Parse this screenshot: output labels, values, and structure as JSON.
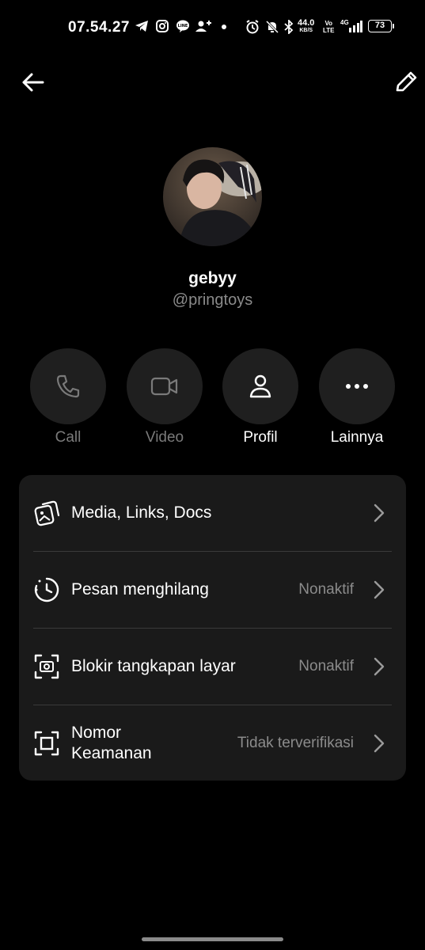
{
  "status_bar": {
    "time": "07.54.27",
    "speed_value": "44.0",
    "speed_unit": "KB/S",
    "volte_top": "Vo",
    "volte_bottom": "LTE",
    "network": "4G",
    "battery": "73"
  },
  "profile": {
    "display_name": "gebyy",
    "username": "@pringtoys"
  },
  "actions": [
    {
      "label": "Call",
      "icon": "phone-icon",
      "enabled": false
    },
    {
      "label": "Video",
      "icon": "video-icon",
      "enabled": false
    },
    {
      "label": "Profil",
      "icon": "person-icon",
      "enabled": true
    },
    {
      "label": "Lainnya",
      "icon": "more-icon",
      "enabled": true
    }
  ],
  "settings": [
    {
      "label": "Media, Links, Docs",
      "value": "",
      "icon": "media-icon"
    },
    {
      "label": "Pesan menghilang",
      "value": "Nonaktif",
      "icon": "timer-icon"
    },
    {
      "label": "Blokir tangkapan layar",
      "value": "Nonaktif",
      "icon": "screenshot-camera-icon"
    },
    {
      "label": "Nomor\nKeamanan",
      "value": "Tidak terverifikasi",
      "icon": "security-frame-icon"
    }
  ],
  "colors": {
    "background": "#000000",
    "card": "#1a1a1a",
    "action_circle": "#1f1f1f",
    "secondary_text": "#8b8b8b",
    "disabled_text": "#7a7a7a"
  }
}
